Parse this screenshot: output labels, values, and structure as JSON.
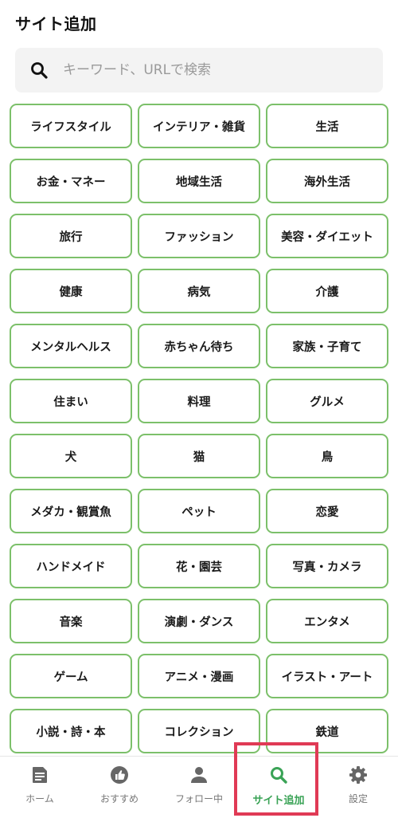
{
  "header": {
    "title": "サイト追加"
  },
  "search": {
    "placeholder": "キーワード、URLで検索"
  },
  "categories": [
    "ライフスタイル",
    "インテリア・雑貨",
    "生活",
    "お金・マネー",
    "地域生活",
    "海外生活",
    "旅行",
    "ファッション",
    "美容・ダイエット",
    "健康",
    "病気",
    "介護",
    "メンタルヘルス",
    "赤ちゃん待ち",
    "家族・子育て",
    "住まい",
    "料理",
    "グルメ",
    "犬",
    "猫",
    "鳥",
    "メダカ・観賞魚",
    "ペット",
    "恋愛",
    "ハンドメイド",
    "花・園芸",
    "写真・カメラ",
    "音楽",
    "演劇・ダンス",
    "エンタメ",
    "ゲーム",
    "アニメ・漫画",
    "イラスト・アート",
    "小説・詩・本",
    "コレクション",
    "鉄道"
  ],
  "tabs": [
    {
      "label": "ホーム",
      "icon": "article-icon"
    },
    {
      "label": "おすすめ",
      "icon": "thumbs-up-icon"
    },
    {
      "label": "フォロー中",
      "icon": "person-icon"
    },
    {
      "label": "サイト追加",
      "icon": "search-icon",
      "active": true
    },
    {
      "label": "設定",
      "icon": "gear-icon"
    }
  ],
  "colors": {
    "accent": "#3aa356",
    "border": "#7cc06a",
    "highlight": "#e03a55"
  }
}
